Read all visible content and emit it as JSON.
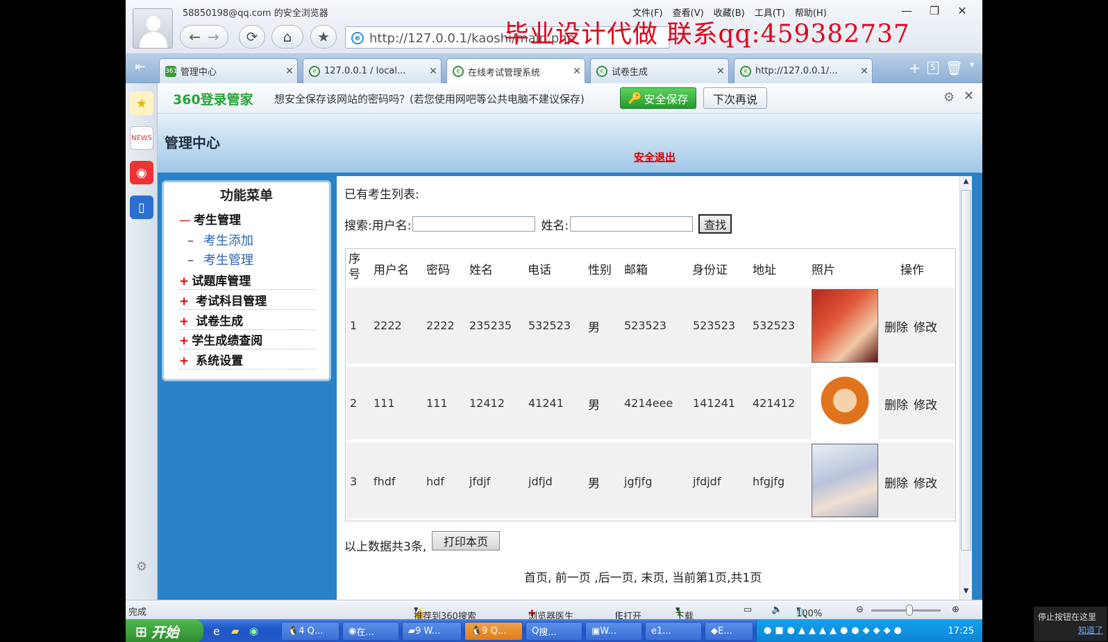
{
  "browser": {
    "user_title": "58850198@qq.com 的安全浏览器",
    "menu": [
      "文件(F)",
      "查看(V)",
      "收藏(B)",
      "工具(T)",
      "帮助(H)"
    ],
    "url": "http://127.0.0.1/kaoshi/main.php",
    "promo_text": "毕业设计代做 联系qq:459382737",
    "tabs": [
      {
        "label": "管理中心",
        "icon": "360-icon"
      },
      {
        "label": "127.0.0.1 / local...",
        "icon": "ie-icon"
      },
      {
        "label": "在线考试管理系统",
        "icon": "ie-icon",
        "active": true
      },
      {
        "label": "试卷生成",
        "icon": "ie-icon"
      },
      {
        "label": "http://127.0.0.1/...",
        "icon": "ie-icon"
      }
    ],
    "tab_count": "5"
  },
  "notice": {
    "logo": "360登录管家",
    "message": "想安全保存该网站的密码吗？(若您使用网吧等公共电脑不建议保存)",
    "save_label": "安全保存",
    "later_label": "下次再说"
  },
  "page": {
    "title": "管理中心",
    "logout": "安全退出",
    "menu_title": "功能菜单",
    "menu": {
      "group1": "考生管理",
      "sub1": "考生添加",
      "sub2": "考生管理",
      "items": [
        "试题库管理",
        "考试科目管理",
        "试卷生成",
        "学生成绩查阅",
        "系统设置"
      ]
    },
    "list_title": "已有考生列表:",
    "search_user_label": "搜索:用户名:",
    "search_name_label": "姓名:",
    "search_user_value": "",
    "search_name_value": "",
    "find_label": "查找",
    "columns": [
      "序号",
      "用户名",
      "密码",
      "姓名",
      "电话",
      "性别",
      "邮箱",
      "身份证",
      "地址",
      "照片",
      "操作"
    ],
    "rows": [
      [
        "1",
        "2222",
        "2222",
        "235235",
        "532523",
        "男",
        "523523",
        "523523",
        "532523"
      ],
      [
        "2",
        "111",
        "111",
        "12412",
        "41241",
        "男",
        "4214eee",
        "141241",
        "421412"
      ],
      [
        "3",
        "fhdf",
        "hdf",
        "jfdjf",
        "jdfjd",
        "男",
        "jgfjfg",
        "jfdjdf",
        "hfgjfg"
      ]
    ],
    "delete_label": "删除",
    "edit_label": "修改",
    "count_text": "以上数据共3条,",
    "print_label": "打印本页",
    "pager_text": "首页, 前一页 ,后一页, 末页, 当前第1页,共1页"
  },
  "statusbar": {
    "left": "完成",
    "recommend": "推荐到360搜索",
    "doctor": "浏览器医生",
    "ie_open": "IE打开",
    "download": "下载",
    "zoom": "100%"
  },
  "taskbar": {
    "start": "开始",
    "items": [
      "4 Q...",
      "在...",
      "9 W...",
      "9 Q...",
      "搜...",
      "W...",
      "1...",
      "E..."
    ],
    "clock": "17:25"
  },
  "tooltip": {
    "text": "停止按钮在这里",
    "link": "知道了"
  }
}
